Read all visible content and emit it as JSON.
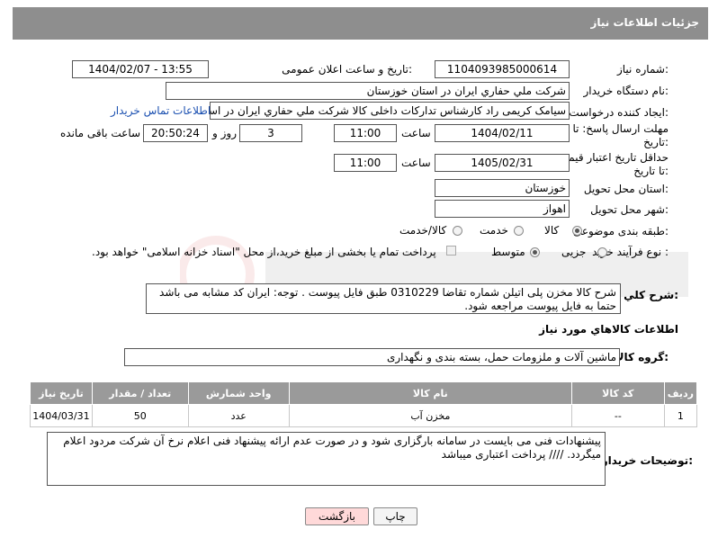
{
  "header": {
    "title": "جزئیات اطلاعات نیاز"
  },
  "labels": {
    "need_number": "شماره نیاز:",
    "announce_datetime": "تاریخ و ساعت اعلان عمومی:",
    "buyer_org": "نام دستگاه خریدار:",
    "creator": "ایجاد کننده درخواست:",
    "reply_deadline": "مهلت ارسال پاسخ: تا تاریخ:",
    "price_validity": "حداقل تاریخ اعتبار قیمت: تا تاریخ:",
    "time": "ساعت",
    "day_and": "روز و",
    "remaining": "ساعت باقی مانده",
    "delivery_province": "استان محل تحویل:",
    "delivery_city": "شهر محل تحویل:",
    "category": "طبقه بندی موضوعی:",
    "process_type": "نوع فرآیند خرید :",
    "general_desc": "شرح کلي نياز:",
    "goods_info": "اطلاعات کالاهاي مورد نياز",
    "goods_group": "گروه کالا:",
    "buyer_notes": "توضیحات خریدار:"
  },
  "values": {
    "need_number": "1104093985000614",
    "announce_datetime": "1404/02/07 - 13:55",
    "buyer_org": "شرکت ملي حفاري ايران در استان خوزستان",
    "creator": "سیامک کریمی راد کارشناس تدارکات داخلی کالا شرکت ملي حفاري ايران در استان خوزستان",
    "contact_link": "اطلاعات تماس خریدار",
    "reply_date": "1404/02/11",
    "reply_time": "11:00",
    "reply_days": "3",
    "reply_remaining": "20:50:24",
    "price_date": "1405/02/31",
    "price_time": "11:00",
    "province": "خوزستان",
    "city": "اهواز",
    "goods_group": "ماشین آلات و ملزومات حمل، بسته بندی و نگهداری",
    "general_desc": "شرح کالا مخزن پلی اتیلن شماره تقاضا 0310229  طبق فایل پیوست . توجه: ایران کد مشابه می باشد حتما به فایل پیوست مراجعه شود.",
    "buyer_notes": "پیشنهادات فنی می بایست در سامانه بارگزاری شود و در صورت عدم ارائه پیشنهاد فنی اعلام نرخ آن شرکت مردود اعلام میگردد.  //// پرداخت اعتباری میباشد"
  },
  "category_options": {
    "goods": "کالا",
    "service": "خدمت",
    "goods_service": "کالا/خدمت"
  },
  "process_options": {
    "partial": "جزیی",
    "medium": "متوسط",
    "payment_note": "پرداخت تمام یا بخشی از مبلغ خرید،از محل \"اسناد خزانه اسلامی\" خواهد بود."
  },
  "table": {
    "headers": [
      "ردیف",
      "کد کالا",
      "نام کالا",
      "واحد شمارش",
      "تعداد / مقدار",
      "تاریخ نیاز"
    ],
    "rows": [
      [
        "1",
        "--",
        "مخزن آب",
        "عدد",
        "50",
        "1404/03/31"
      ]
    ]
  },
  "buttons": {
    "print": "چاپ",
    "back": "بازگشت"
  },
  "colors": {
    "header_bg": "#8e8e8e",
    "link": "#1a4fb0",
    "back_button": "#ffd9d9"
  }
}
